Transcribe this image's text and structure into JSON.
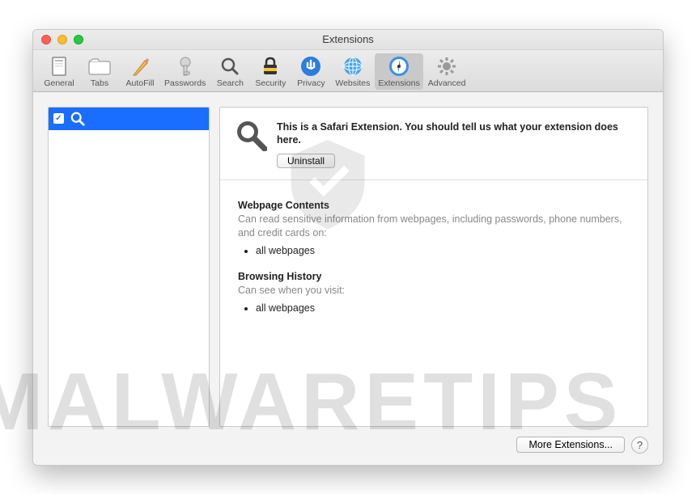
{
  "window": {
    "title": "Extensions"
  },
  "toolbar": {
    "items": [
      {
        "label": "General"
      },
      {
        "label": "Tabs"
      },
      {
        "label": "AutoFill"
      },
      {
        "label": "Passwords"
      },
      {
        "label": "Search"
      },
      {
        "label": "Security"
      },
      {
        "label": "Privacy"
      },
      {
        "label": "Websites"
      },
      {
        "label": "Extensions"
      },
      {
        "label": "Advanced"
      }
    ]
  },
  "extension": {
    "description": "This is a Safari Extension. You should tell us what your extension does here.",
    "uninstall_label": "Uninstall"
  },
  "permissions": {
    "section1_title": "Webpage Contents",
    "section1_desc": "Can read sensitive information from webpages, including passwords, phone numbers, and credit cards on:",
    "section1_item": "all webpages",
    "section2_title": "Browsing History",
    "section2_desc": "Can see when you visit:",
    "section2_item": "all webpages"
  },
  "footer": {
    "more_label": "More Extensions...",
    "help_label": "?"
  },
  "watermark": "MALWARETIPS"
}
